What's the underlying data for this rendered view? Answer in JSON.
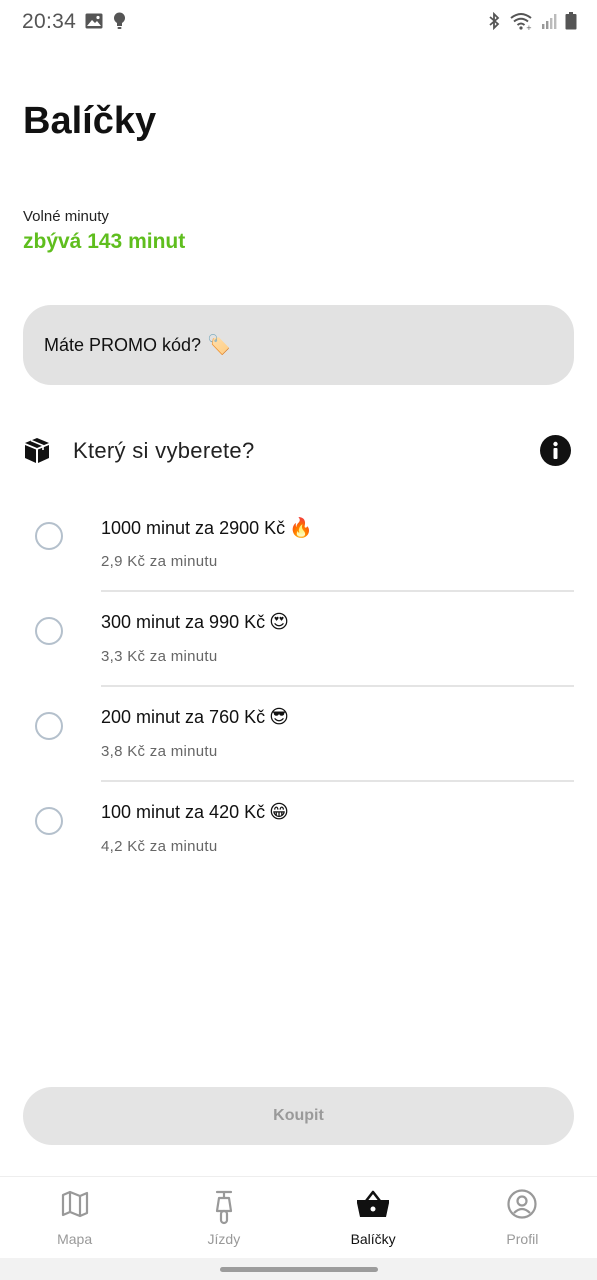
{
  "status_bar": {
    "time": "20:34",
    "left_icons": [
      "image-icon",
      "bulb-icon"
    ],
    "right_icons": [
      "bluetooth-icon",
      "wifi-icon",
      "signal-icon",
      "battery-icon"
    ]
  },
  "header": {
    "title": "Balíčky"
  },
  "free_minutes": {
    "label": "Volné minuty",
    "value": "zbývá 143 minut",
    "color": "#5fbe1e"
  },
  "promo": {
    "label": "Máte PROMO kód?",
    "emoji": "🏷️"
  },
  "section": {
    "title": "Který si vyberete?",
    "icon": "box-icon",
    "info_icon": "info-icon"
  },
  "packages": [
    {
      "title": "1000 minut za 2900 Kč",
      "emoji": "🔥",
      "subtitle": "2,9 Kč za minutu",
      "selected": false
    },
    {
      "title": "300 minut za 990 Kč",
      "emoji": "😍",
      "subtitle": "3,3 Kč za minutu",
      "selected": false
    },
    {
      "title": "200 minut za 760 Kč",
      "emoji": "😎",
      "subtitle": "3,8 Kč za minutu",
      "selected": false
    },
    {
      "title": "100 minut za 420 Kč",
      "emoji": "😁",
      "subtitle": "4,2 Kč za minutu",
      "selected": false
    }
  ],
  "buy_button": {
    "label": "Koupit",
    "enabled": false
  },
  "bottom_nav": {
    "items": [
      {
        "label": "Mapa",
        "icon": "map-icon",
        "active": false
      },
      {
        "label": "Jízdy",
        "icon": "scooter-icon",
        "active": false
      },
      {
        "label": "Balíčky",
        "icon": "basket-icon",
        "active": true
      },
      {
        "label": "Profil",
        "icon": "profile-icon",
        "active": false
      }
    ]
  }
}
